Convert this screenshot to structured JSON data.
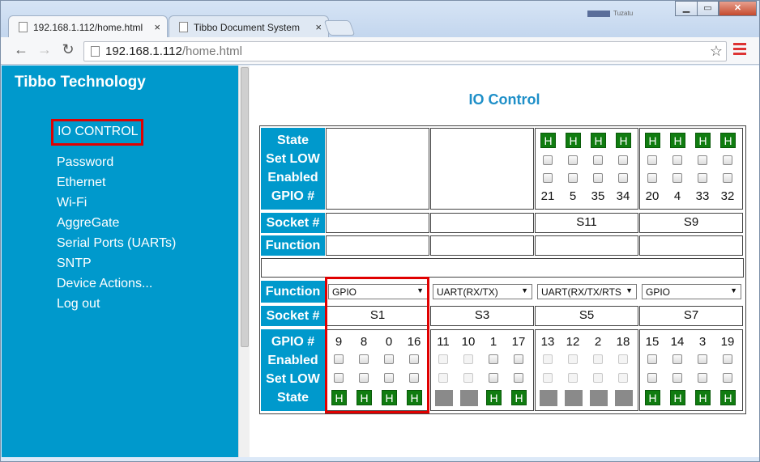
{
  "browser": {
    "tabs": [
      {
        "label": "192.168.1.112/home.html",
        "close": "×"
      },
      {
        "label": "Tibbo Document System",
        "close": "×"
      }
    ],
    "profile_label": "Tuzatu",
    "window_controls": {
      "minimize": "▁",
      "maximize": "▭",
      "close": "✕"
    },
    "url_host": "192.168.1.112",
    "url_path": "/home.html",
    "nav_icons": {
      "back": "←",
      "forward": "→",
      "reload": "↻",
      "star": "☆"
    },
    "accent_color": "#dd3333"
  },
  "sidebar": {
    "brand": "Tibbo Technology",
    "active_item": "IO CONTROL",
    "items": [
      "Password",
      "Ethernet",
      "Wi-Fi",
      "AggreGate",
      "Serial Ports (UARTs)",
      "SNTP",
      "Device Actions...",
      "Log out"
    ],
    "color": "#0099cc"
  },
  "page": {
    "title": "IO Control",
    "top_labels": [
      "State",
      "Set LOW",
      "Enabled",
      "GPIO #"
    ],
    "socket_label": "Socket #",
    "function_label": "Function",
    "bottom_labels": [
      "GPIO #",
      "Enabled",
      "Set LOW",
      "State"
    ],
    "top_groups": [
      {
        "socket": "",
        "function": "",
        "gpio": [],
        "states": []
      },
      {
        "socket": "",
        "function": "",
        "gpio": [],
        "states": []
      },
      {
        "socket": "S11",
        "function": "",
        "gpio": [
          "21",
          "5",
          "35",
          "34"
        ],
        "states": [
          "H",
          "H",
          "H",
          "H"
        ]
      },
      {
        "socket": "S9",
        "function": "",
        "gpio": [
          "20",
          "4",
          "33",
          "32"
        ],
        "states": [
          "H",
          "H",
          "H",
          "H"
        ]
      }
    ],
    "bottom_groups": [
      {
        "socket": "S1",
        "function": "GPIO",
        "gpio": [
          "9",
          "8",
          "0",
          "16"
        ],
        "enabled_active": [
          true,
          true,
          true,
          true
        ],
        "states": [
          "H",
          "H",
          "H",
          "H"
        ]
      },
      {
        "socket": "S3",
        "function": "UART(RX/TX)",
        "gpio": [
          "11",
          "10",
          "1",
          "17"
        ],
        "enabled_active": [
          false,
          false,
          true,
          true
        ],
        "states": [
          "",
          "",
          "H",
          "H"
        ]
      },
      {
        "socket": "S5",
        "function": "UART(RX/TX/RTS",
        "gpio": [
          "13",
          "12",
          "2",
          "18"
        ],
        "enabled_active": [
          false,
          false,
          false,
          false
        ],
        "states": [
          "",
          "",
          "",
          ""
        ]
      },
      {
        "socket": "S7",
        "function": "GPIO",
        "gpio": [
          "15",
          "14",
          "3",
          "19"
        ],
        "enabled_active": [
          true,
          true,
          true,
          true
        ],
        "states": [
          "H",
          "H",
          "H",
          "H"
        ]
      }
    ],
    "state_on_color": "#107c10",
    "state_off_color": "#8a8a8a",
    "highlight_color": "#e00000"
  }
}
